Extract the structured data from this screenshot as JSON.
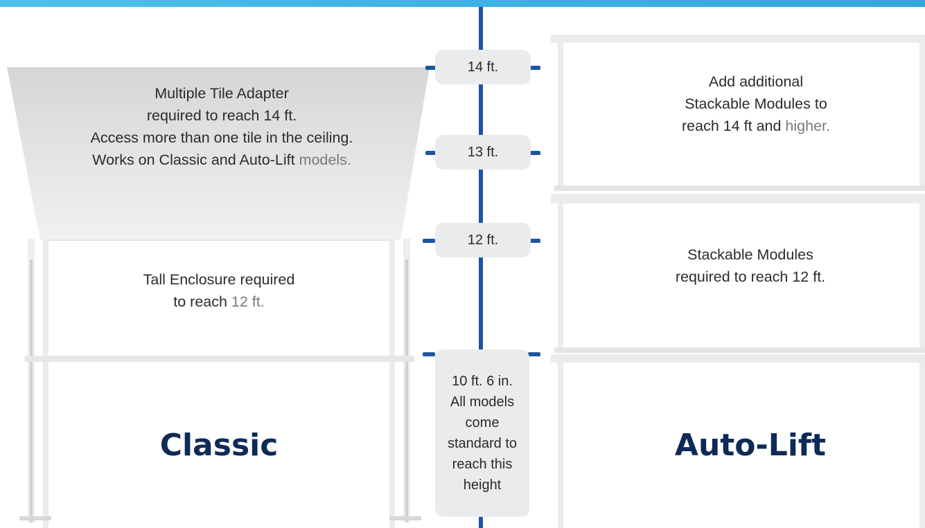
{
  "markers": {
    "m14": "14 ft.",
    "m13": "13 ft.",
    "m12": "12 ft.",
    "m10": [
      "10 ft. 6 in.",
      "All models",
      "come",
      "standard to",
      "reach this",
      "height"
    ]
  },
  "classic": {
    "adapter_lines": [
      "Multiple Tile Adapter",
      "required to reach 14 ft.",
      "Access more than one tile in the ceiling."
    ],
    "adapter_last_line_main": "Works on Classic and Auto-Lift",
    "adapter_last_line_muted": "models.",
    "tall_line1": "Tall Enclosure required",
    "tall_line2_main": "to reach",
    "tall_line2_muted": "12 ft.",
    "label": "Classic"
  },
  "autolift": {
    "stack_top_line1": "Add additional",
    "stack_top_line2": "Stackable Modules to",
    "stack_top_line3_main": "reach 14 ft and",
    "stack_top_line3_muted": "higher.",
    "stack_mid_line1": "Stackable Modules",
    "stack_mid_line2": "required to reach 12 ft.",
    "label": "Auto-Lift"
  }
}
